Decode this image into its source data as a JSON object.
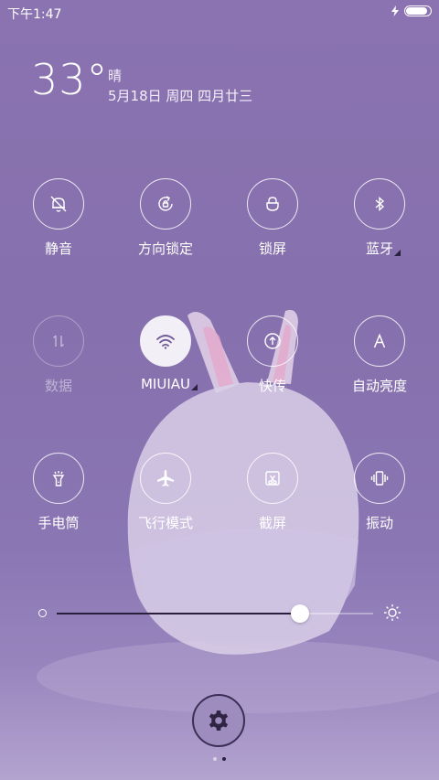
{
  "status_bar": {
    "time": "下午1:47",
    "icons": [
      "charging-bolt-icon",
      "battery-icon"
    ],
    "battery_level": 0.9
  },
  "weather": {
    "temperature": "33°",
    "condition": "晴",
    "date": "5月18日 周四 四月廿三"
  },
  "toggles": [
    {
      "label": "静音",
      "icon": "bell-off-icon",
      "state": "off",
      "has_menu": false
    },
    {
      "label": "方向锁定",
      "icon": "rotation-lock-icon",
      "state": "off",
      "has_menu": false
    },
    {
      "label": "锁屏",
      "icon": "lock-icon",
      "state": "off",
      "has_menu": false
    },
    {
      "label": "蓝牙",
      "icon": "bluetooth-icon",
      "state": "off",
      "has_menu": true
    },
    {
      "label": "数据",
      "icon": "mobile-data-icon",
      "state": "disabled",
      "has_menu": false
    },
    {
      "label": "MIUIAU",
      "icon": "wifi-icon",
      "state": "on",
      "has_menu": true
    },
    {
      "label": "快传",
      "icon": "upload-icon",
      "state": "off",
      "has_menu": false
    },
    {
      "label": "自动亮度",
      "icon": "auto-brightness-icon",
      "state": "off",
      "has_menu": false
    },
    {
      "label": "手电筒",
      "icon": "flashlight-icon",
      "state": "off",
      "has_menu": false
    },
    {
      "label": "飞行模式",
      "icon": "airplane-icon",
      "state": "off",
      "has_menu": false
    },
    {
      "label": "截屏",
      "icon": "screenshot-icon",
      "state": "off",
      "has_menu": false
    },
    {
      "label": "振动",
      "icon": "vibrate-icon",
      "state": "off",
      "has_menu": false
    }
  ],
  "brightness": {
    "value": 0.77
  },
  "pager": {
    "pages": 2,
    "current": 2
  },
  "colors": {
    "accent_dark": "#2a1f3d",
    "background": "#8670ad"
  }
}
